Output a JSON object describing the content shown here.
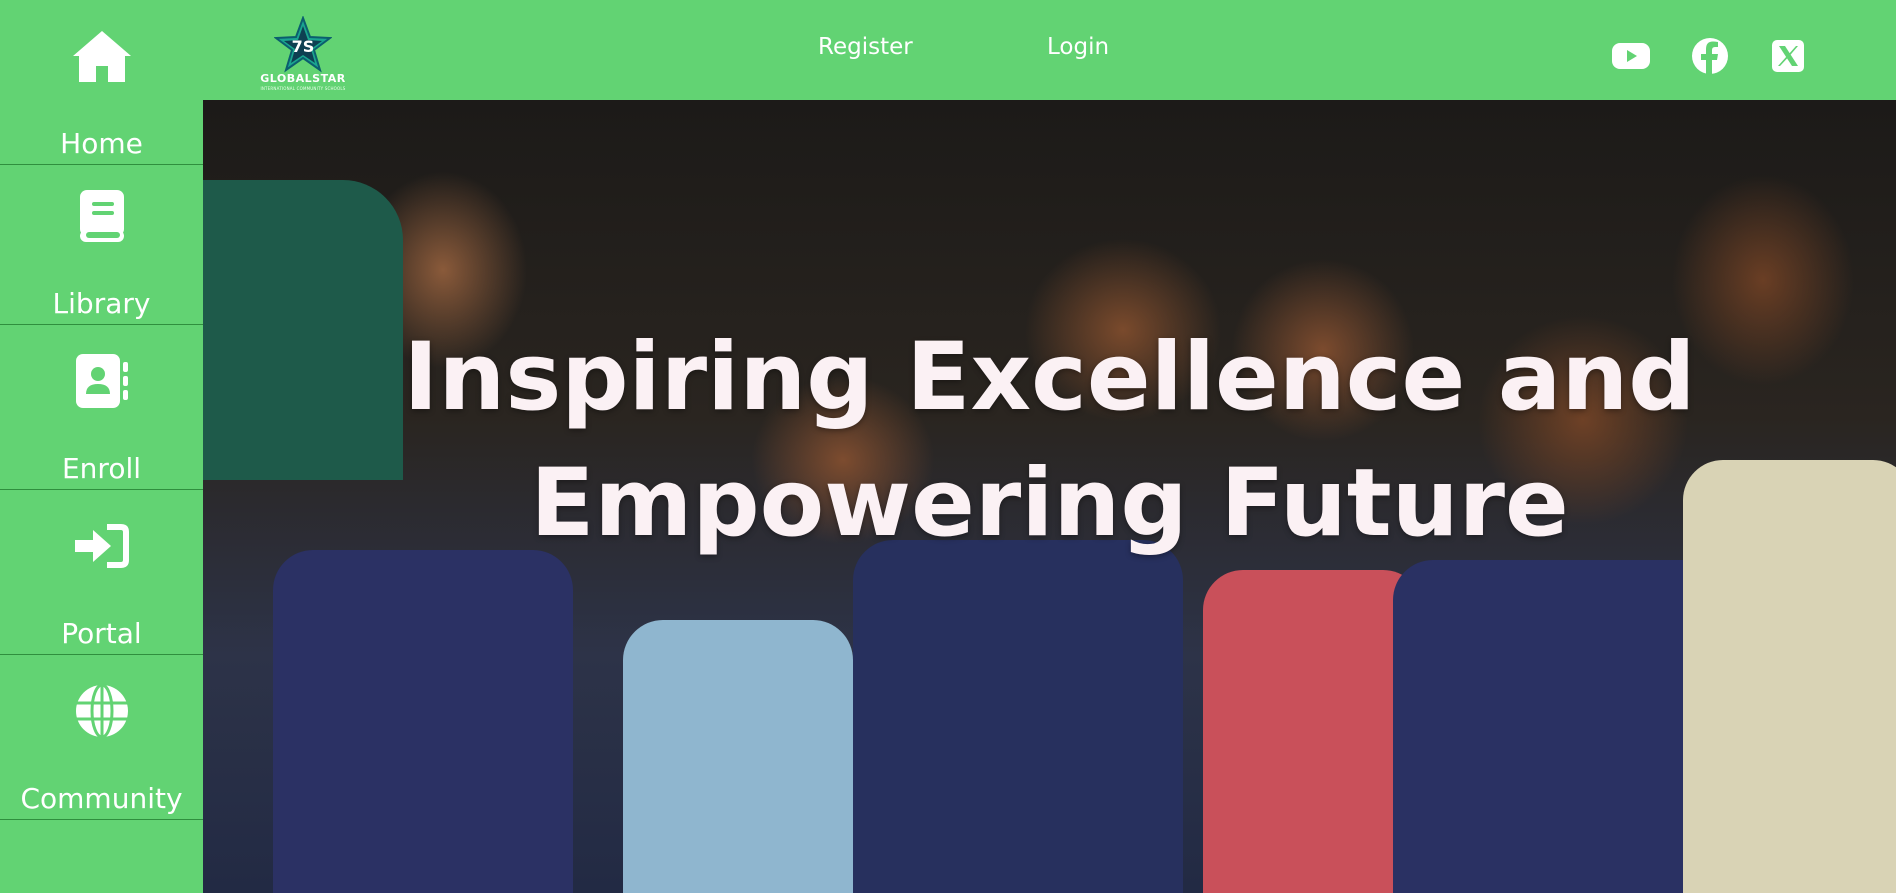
{
  "sidebar": {
    "items": [
      {
        "label": "Home",
        "icon": "home-icon"
      },
      {
        "label": "Library",
        "icon": "book-icon"
      },
      {
        "label": "Enroll",
        "icon": "contact-book-icon"
      },
      {
        "label": "Portal",
        "icon": "sign-in-icon"
      },
      {
        "label": "Community",
        "icon": "globe-icon"
      }
    ]
  },
  "header": {
    "logo": {
      "name": "GLOBALSTAR",
      "tagline": "INTERNATIONAL COMMUNITY SCHOOLS"
    },
    "nav": {
      "register_label": "Register",
      "login_label": "Login"
    },
    "social": [
      "youtube-icon",
      "facebook-icon",
      "x-icon"
    ]
  },
  "hero": {
    "title_line1": "Inspiring Excellence and",
    "title_line2": "Empowering Future"
  },
  "colors": {
    "brand_green": "#62d373",
    "hero_text": "#fbf1f4"
  }
}
